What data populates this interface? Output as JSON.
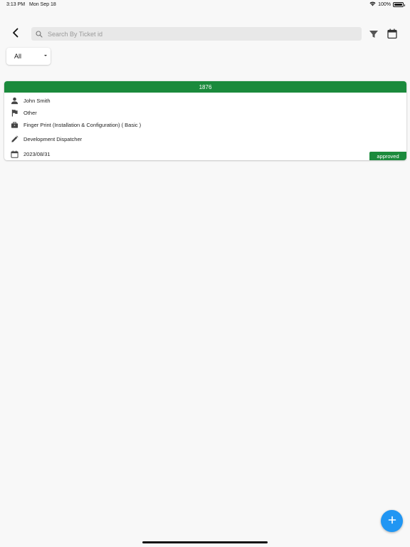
{
  "status_bar": {
    "time": "3:13 PM",
    "date": "Mon Sep 18",
    "battery": "100%"
  },
  "header": {
    "back_icon": "chevron-left-icon",
    "search": {
      "placeholder": "Search By Ticket id",
      "value": ""
    },
    "filter_icon": "filter-icon",
    "calendar_icon": "calendar-icon"
  },
  "filter_dropdown": {
    "selected": "All"
  },
  "tickets": [
    {
      "id": "1876",
      "person": "John Smith",
      "category": "Other",
      "service": "Finger Print (Installation & Configuration) ( Basic )",
      "role": "Development Dispatcher",
      "date": "2023/08/31",
      "status": "approved"
    }
  ],
  "fab": {
    "icon": "plus-icon"
  },
  "colors": {
    "accent_green": "#1b8a3c",
    "fab_blue": "#2196f3",
    "background": "#f8f8f8"
  }
}
